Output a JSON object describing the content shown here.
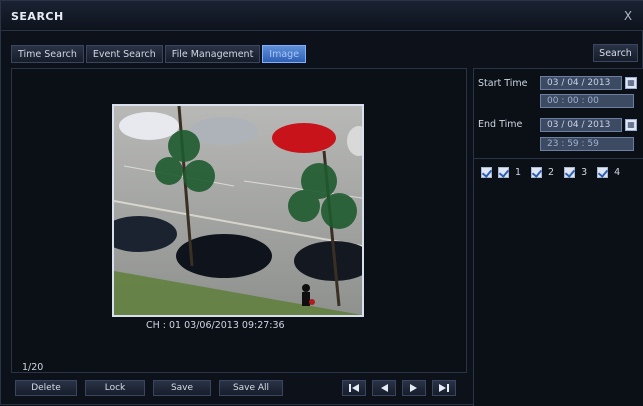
{
  "window": {
    "title": "SEARCH",
    "close_label": "X"
  },
  "tabs": [
    {
      "label": "Time Search",
      "active": false
    },
    {
      "label": "Event Search",
      "active": false
    },
    {
      "label": "File Management",
      "active": false
    },
    {
      "label": "Image",
      "active": true
    }
  ],
  "top_search_label": "Search",
  "viewer": {
    "caption": "CH : 01  03/06/2013 09:27:36",
    "counter": "1/20"
  },
  "actions": {
    "delete": "Delete",
    "lock": "Lock",
    "save": "Save",
    "save_all": "Save All"
  },
  "nav_icons": [
    "first-icon",
    "prev-icon",
    "next-icon",
    "last-icon"
  ],
  "filters": {
    "start_time_label": "Start Time",
    "start_date": "03 / 04 / 2013",
    "start_clock": "00 : 00 : 00",
    "end_time_label": "End Time",
    "end_date": "03 / 04 / 2013",
    "end_clock": "23 : 59 : 59"
  },
  "channels": {
    "labels": [
      "1",
      "2",
      "3",
      "4"
    ]
  },
  "colors": {
    "accent": "#2f5fb3",
    "tab_active": "#5f8fd8"
  }
}
